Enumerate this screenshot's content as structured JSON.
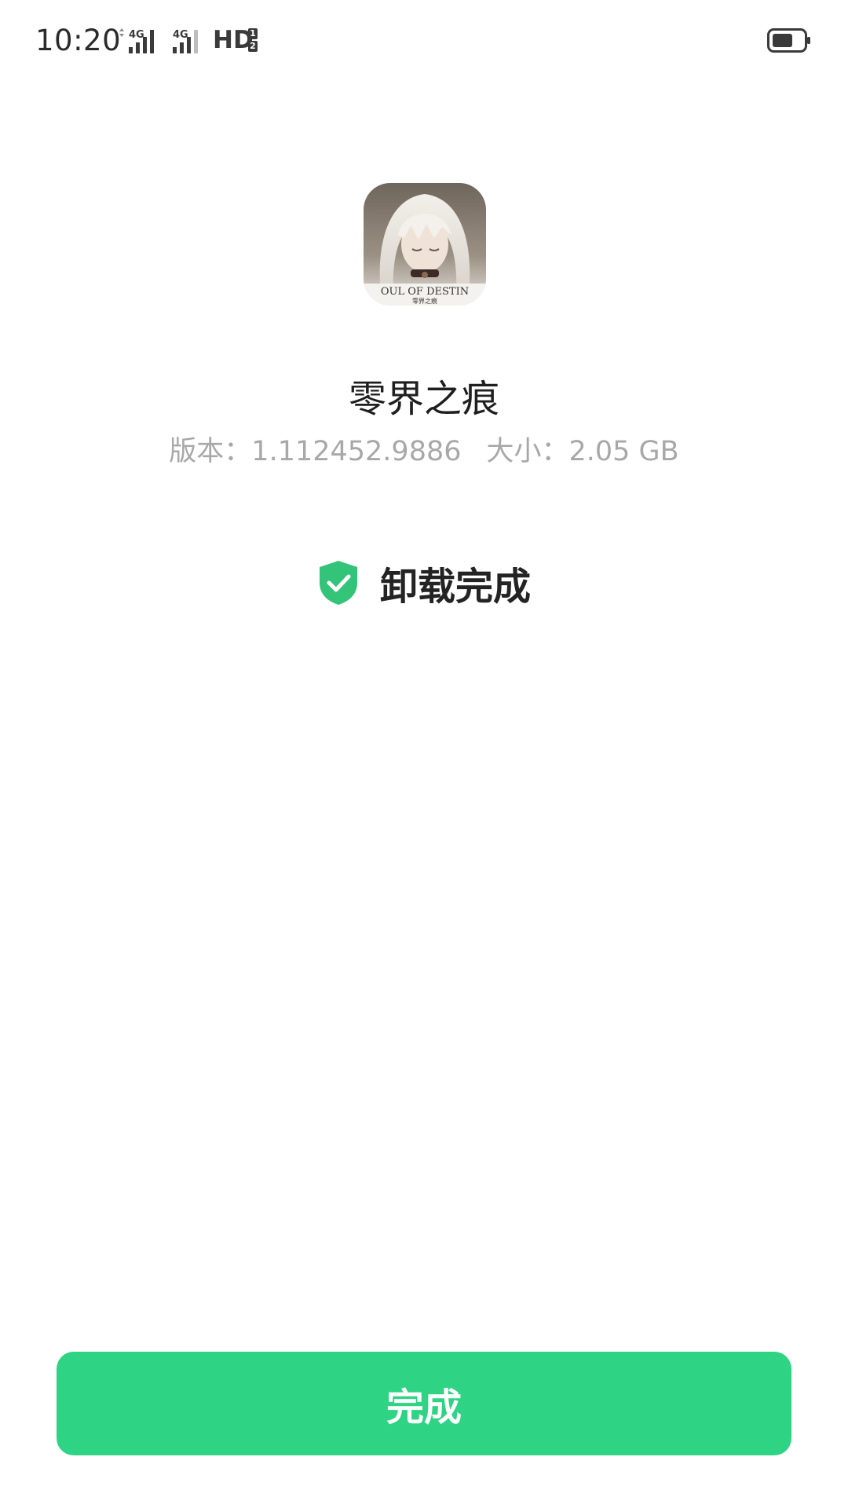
{
  "status_bar": {
    "time": "10:20",
    "network_1": "4G",
    "network_2": "4G",
    "hd_label": "HD",
    "hd_sim_top": "1",
    "hd_sim_bottom": "2",
    "icons": [
      "data-arrows-icon",
      "signal-icon",
      "signal-icon",
      "battery-icon"
    ]
  },
  "app": {
    "icon_text_line1": "OUL OF DESTIN",
    "icon_text_line2": "零界之痕",
    "name": "零界之痕",
    "version_label": "版本：1.112452.9886",
    "size_label": "大小：2.05 GB"
  },
  "result": {
    "icon": "shield-check-icon",
    "text": "卸载完成"
  },
  "footer": {
    "done_label": "完成"
  },
  "colors": {
    "accent": "#2fd384",
    "shield": "#33c47a",
    "text_primary": "#1f1f1f",
    "text_secondary": "#a8a8a8"
  }
}
